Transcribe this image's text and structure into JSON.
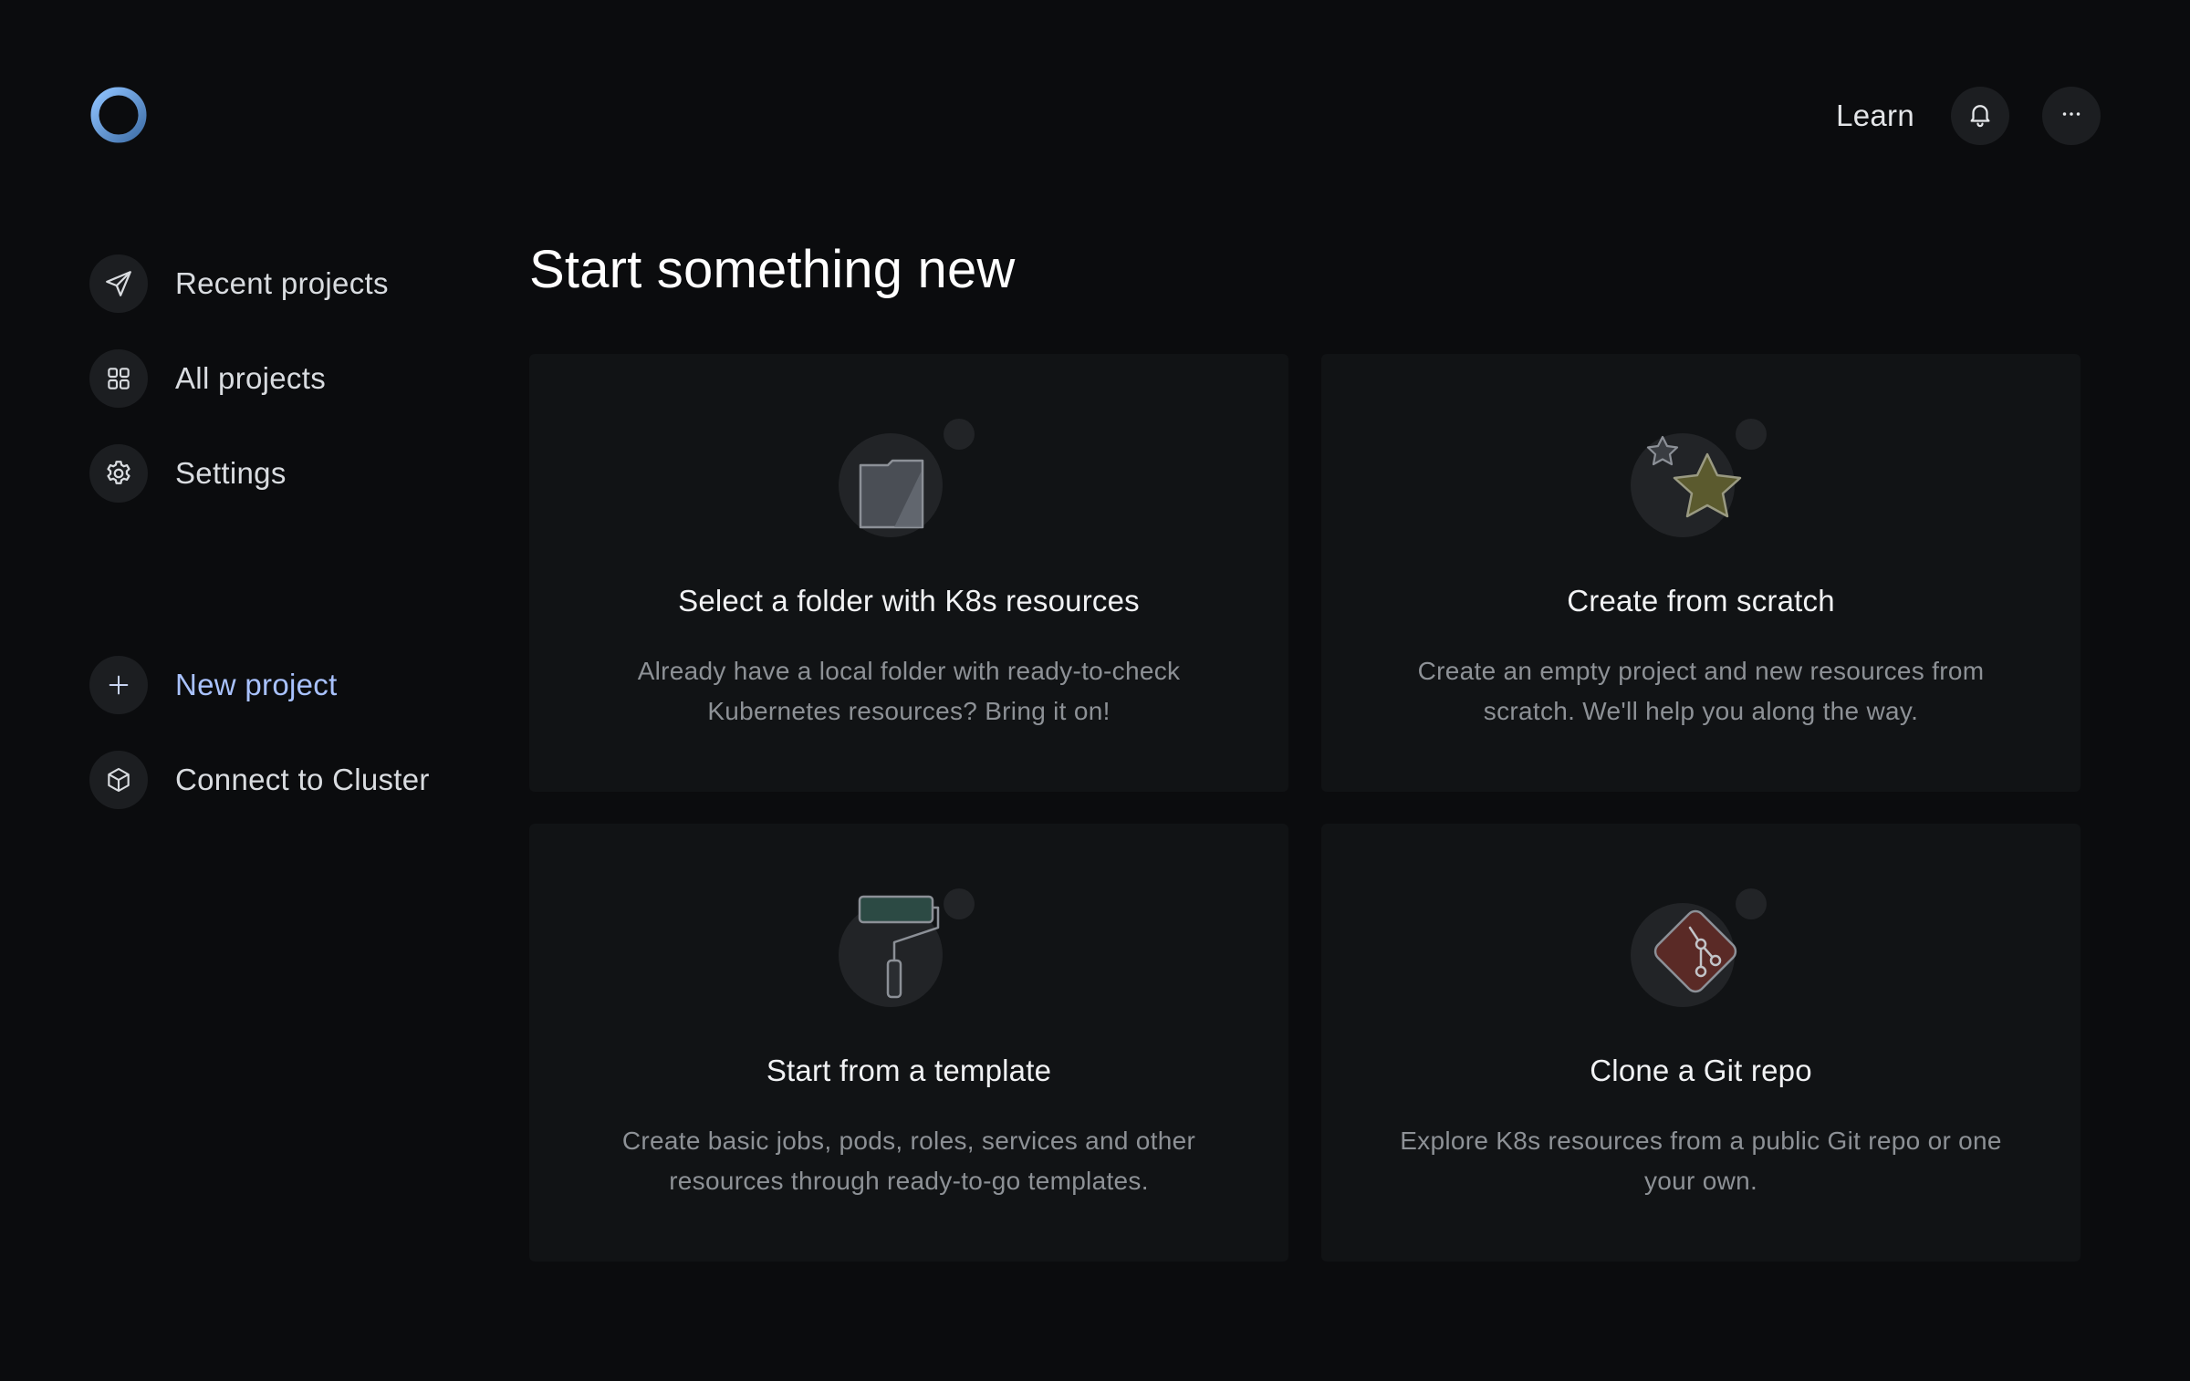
{
  "header": {
    "logo_icon": "ring-logo-icon",
    "learn_label": "Learn",
    "notifications_icon": "bell-icon",
    "more_icon": "more-dots-icon"
  },
  "sidebar": {
    "items": [
      {
        "label": "Recent projects",
        "icon": "paper-plane-icon"
      },
      {
        "label": "All projects",
        "icon": "grid-icon"
      },
      {
        "label": "Settings",
        "icon": "gear-icon"
      }
    ],
    "actions": [
      {
        "label": "New project",
        "icon": "plus-icon",
        "color": "#a9c2ff"
      },
      {
        "label": "Connect to Cluster",
        "icon": "cube-icon"
      }
    ]
  },
  "main": {
    "title": "Start something new",
    "cards": [
      {
        "title": "Select a folder with K8s resources",
        "description": "Already have a local folder with ready-to-check Kubernetes resources? Bring it on!",
        "icon": "folder-icon"
      },
      {
        "title": "Create from scratch",
        "description": "Create an empty project and new resources from scratch. We'll help you along the way.",
        "icon": "star-icon"
      },
      {
        "title": "Start from a template",
        "description": "Create basic jobs, pods, roles, services and other resources through ready-to-go templates.",
        "icon": "paint-roller-icon"
      },
      {
        "title": "Clone a Git repo",
        "description": "Explore K8s resources from a public Git repo or one your own.",
        "icon": "git-icon"
      }
    ]
  },
  "colors": {
    "background": "#0b0c0e",
    "card": "#111315",
    "accent": "#a9c2ff",
    "star": "#5b5a2e",
    "roller": "#2c4a44",
    "git": "#5a2a26"
  }
}
